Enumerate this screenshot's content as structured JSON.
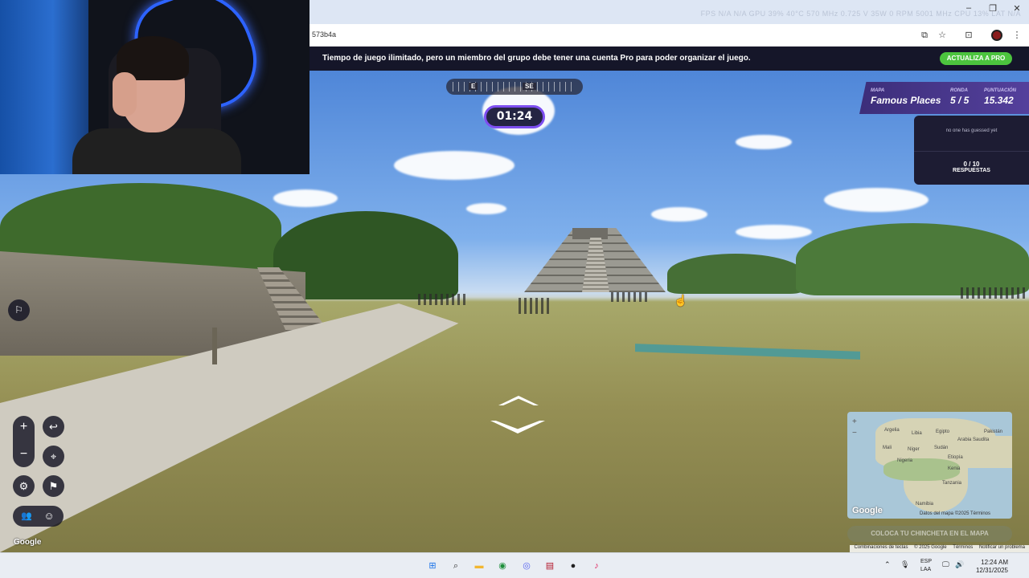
{
  "browser": {
    "url_fragment": "573b4a",
    "perf_overlay": "FPS N/A N/A  GPU 39% 40°C 570 MHz 0.725 V 35W 0 RPM 5001 MHz  CPU 13%  LAT N/A",
    "window_controls": {
      "minimize": "–",
      "maximize": "❐",
      "close": "✕"
    },
    "icons": {
      "cast": "⧉",
      "bookmark": "☆",
      "media": "⊡",
      "menu": "⋮"
    }
  },
  "promo": {
    "message": "Tiempo de juego ilimitado, pero un miembro del grupo debe tener una cuenta Pro para poder organizar el juego.",
    "button": "ACTUALIZA A PRO"
  },
  "compass": {
    "left_dir": "E",
    "right_dir": "SE"
  },
  "timer": "01:24",
  "game": {
    "map_label": "MAPA",
    "map_value": "Famous Places",
    "round_label": "RONDA",
    "round_value": "5 / 5",
    "score_label": "PUNTUACIÓN",
    "score_value": "15.342"
  },
  "guesses": {
    "status": "no one has guessed yet",
    "count": "0 / 10",
    "label": "RESPUESTAS"
  },
  "controls": {
    "zoom_in": "+",
    "zoom_out": "−",
    "undo_icon": "↩",
    "pin_icon": "⌖",
    "settings_icon": "⚙",
    "flag_icon": "⚑",
    "people_icon": "👥",
    "avatar_icon": "☺"
  },
  "street_view": {
    "google_logo": "Google"
  },
  "minimap": {
    "zoom_in": "+",
    "zoom_out": "−",
    "labels": [
      "Argelia",
      "Libia",
      "Egipto",
      "Mali",
      "Níger",
      "Sudán",
      "Arabia Saudita",
      "Pakistán",
      "Nigeria",
      "Etiopía",
      "Kenia",
      "Tanzania",
      "Namibia"
    ],
    "google_logo": "Google",
    "attribution": "Datos del mapa ©2025   Términos"
  },
  "pin_button": "COLOCA TU CHINCHETA EN EL MAPA",
  "footer_links": [
    "Combinaciones de teclas",
    "© 2025 Google",
    "Términos",
    "Notificar un problema"
  ],
  "taskbar": {
    "apps": [
      {
        "name": "start",
        "icon": "⊞",
        "color": "#1a73e8"
      },
      {
        "name": "search",
        "icon": "⌕",
        "color": "#333333"
      },
      {
        "name": "explorer",
        "icon": "▬",
        "color": "#f2b630"
      },
      {
        "name": "chrome",
        "icon": "◉",
        "color": "#1f8f3c"
      },
      {
        "name": "discord",
        "icon": "◎",
        "color": "#5865f2"
      },
      {
        "name": "app-red",
        "icon": "▤",
        "color": "#b3182b"
      },
      {
        "name": "app-dark",
        "icon": "●",
        "color": "#202020"
      },
      {
        "name": "tiktok",
        "icon": "♪",
        "color": "#e0245e"
      }
    ],
    "lang_top": "ESP",
    "lang_bottom": "LAA",
    "time": "12:24 AM",
    "date": "12/31/2025",
    "tray_icons": [
      "⌃",
      "🎙",
      "🖵",
      "🔊"
    ]
  }
}
